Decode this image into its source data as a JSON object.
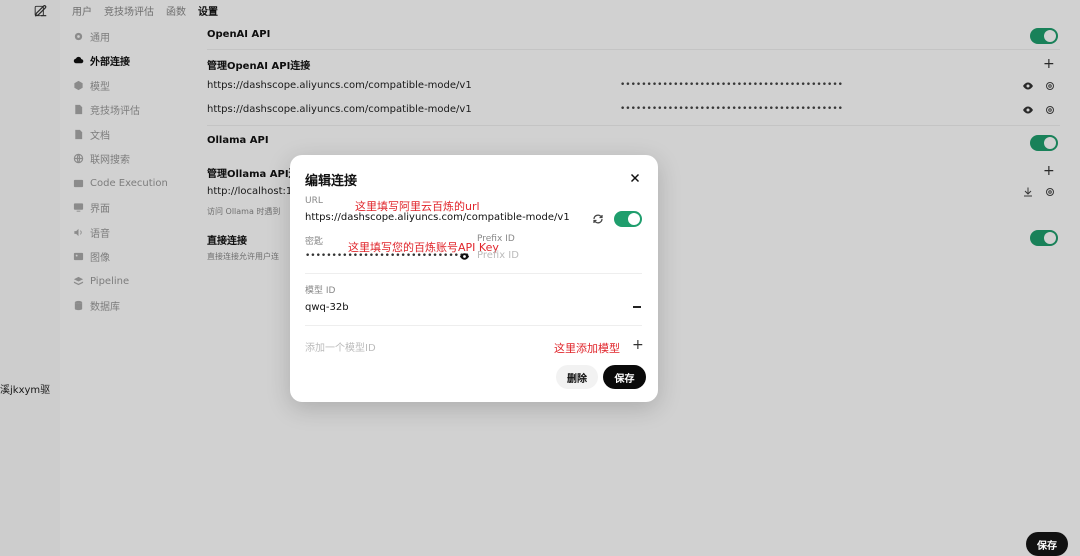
{
  "left": {
    "user_label": "溪jkxym驱"
  },
  "topnav": {
    "items": [
      "用户",
      "竞技场评估",
      "函数",
      "设置"
    ]
  },
  "sidebar": {
    "items": [
      {
        "label": "通用",
        "icon": "gear-icon"
      },
      {
        "label": "外部连接",
        "icon": "cloud-icon"
      },
      {
        "label": "模型",
        "icon": "cube-icon"
      },
      {
        "label": "竞技场评估",
        "icon": "document-icon"
      },
      {
        "label": "文档",
        "icon": "document-icon"
      },
      {
        "label": "联网搜索",
        "icon": "globe-icon"
      },
      {
        "label": "Code Execution",
        "icon": "terminal-icon"
      },
      {
        "label": "界面",
        "icon": "monitor-icon"
      },
      {
        "label": "语音",
        "icon": "speaker-icon"
      },
      {
        "label": "图像",
        "icon": "image-icon"
      },
      {
        "label": "Pipeline",
        "icon": "layers-icon"
      },
      {
        "label": "数据库",
        "icon": "database-icon"
      }
    ]
  },
  "settings": {
    "openai_title": "OpenAI API",
    "manage_openai": "管理OpenAI API连接",
    "openai_connections": [
      {
        "url": "https://dashscope.aliyuncs.com/compatible-mode/v1",
        "key": "••••••••••••••••••••••••••••••••••••••••••"
      },
      {
        "url": "https://dashscope.aliyuncs.com/compatible-mode/v1",
        "key": "••••••••••••••••••••••••••••••••••••••••••"
      }
    ],
    "ollama_title": "Ollama API",
    "manage_ollama": "管理Ollama API连",
    "ollama_url": "http://localhost:1",
    "ollama_hint": "访问 Ollama 时遇到",
    "direct_title": "直接连接",
    "direct_hint": "直接连接允许用户连"
  },
  "modal": {
    "title": "编辑连接",
    "url_label": "URL",
    "url_value": "https://dashscope.aliyuncs.com/compatible-mode/v1",
    "key_label": "密匙",
    "key_value": "•••••••••••••••••••••••••••••••",
    "prefix_label": "Prefix ID",
    "prefix_placeholder": "Prefix ID",
    "model_id_label": "模型 ID",
    "model_id_value": "qwq-32b",
    "add_model_placeholder": "添加一个模型ID",
    "delete_label": "删除",
    "save_label": "保存",
    "annot_url": "这里填写阿里云百炼的url",
    "annot_key": "这里填写您的百炼账号API Key",
    "annot_model": "这里添加模型"
  },
  "footer": {
    "save_label": "保存"
  },
  "colors": {
    "toggle_on": "#1f9e6d",
    "annotation": "#e0252b"
  }
}
